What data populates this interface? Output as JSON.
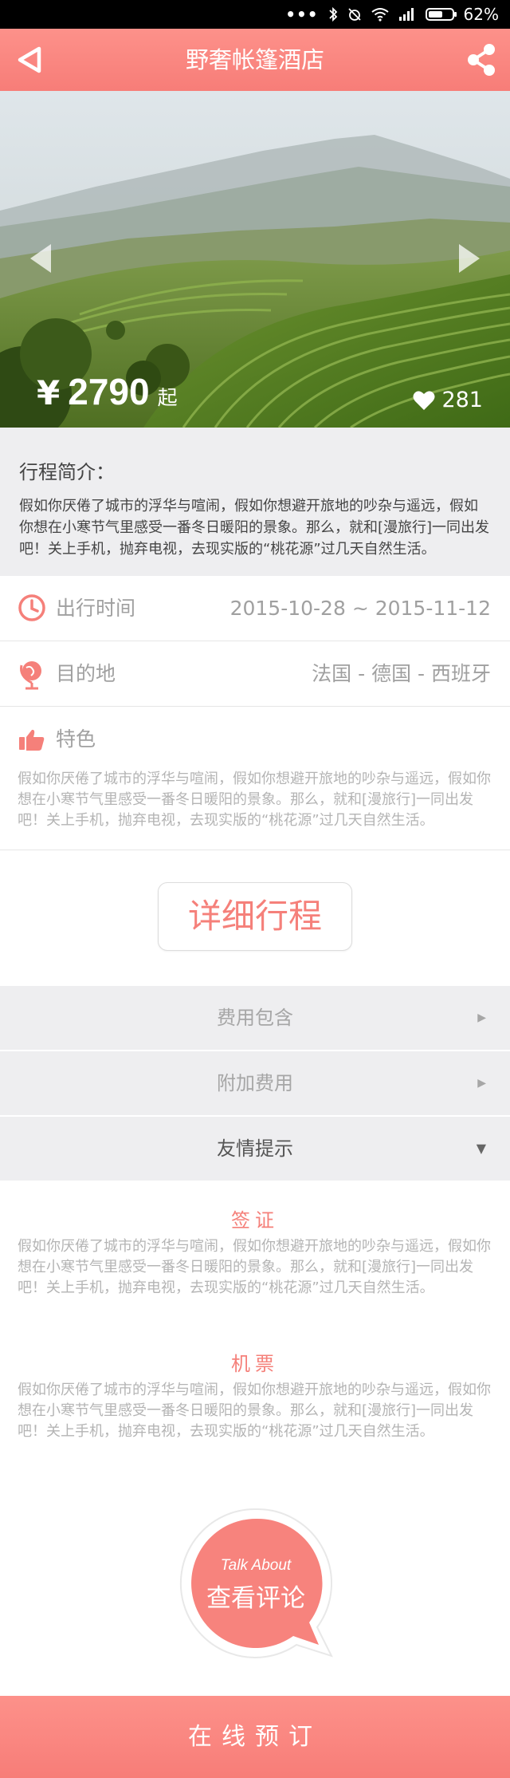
{
  "status_bar": {
    "dots": "•••",
    "battery": "62%",
    "battery_level": 0.62
  },
  "navbar": {
    "title": "野奢帐篷酒店",
    "back_icon": "back-triangle-icon",
    "share_icon": "share-icon"
  },
  "hero": {
    "currency": "¥",
    "price": "2790",
    "price_suffix": "起",
    "likes": "281",
    "like_icon": "heart-icon"
  },
  "intro": {
    "heading": "行程简介：",
    "text": "假如你厌倦了城市的浮华与喧闹，假如你想避开旅地的吵杂与遥远，假如你想在小寒节气里感受一番冬日暖阳的景象。那么，就和[漫旅行]一同出发吧！关上手机，抛弃电视，去现实版的“桃花源”过几天自然生活。"
  },
  "info": {
    "time_label": "出行时间",
    "time_value": "2015-10-28 ~ 2015-11-12",
    "dest_label": "目的地",
    "dest_value": "法国 - 德国 - 西班牙",
    "feature_label": "特色",
    "feature_text": "假如你厌倦了城市的浮华与喧闹，假如你想避开旅地的吵杂与遥远，假如你想在小寒节气里感受一番冬日暖阳的景象。那么，就和[漫旅行]一同出发吧！关上手机，抛弃电视，去现实版的“桃花源”过几天自然生活。"
  },
  "detail_button": "详细行程",
  "accordion": [
    {
      "label": "费用包含",
      "arrow": "▶"
    },
    {
      "label": "附加费用",
      "arrow": "▶"
    },
    {
      "label": "友情提示",
      "arrow": "▼"
    }
  ],
  "tips": [
    {
      "title": "签证",
      "text": "假如你厌倦了城市的浮华与喧闹，假如你想避开旅地的吵杂与遥远，假如你想在小寒节气里感受一番冬日暖阳的景象。那么，就和[漫旅行]一同出发吧！关上手机，抛弃电视，去现实版的“桃花源”过几天自然生活。"
    },
    {
      "title": "机票",
      "text": "假如你厌倦了城市的浮华与喧闹，假如你想避开旅地的吵杂与遥远，假如你想在小寒节气里感受一番冬日暖阳的景象。那么，就和[漫旅行]一同出发吧！关上手机，抛弃电视，去现实版的“桃花源”过几天自然生活。"
    }
  ],
  "talk": {
    "en": "Talk About",
    "cn": "查看评论"
  },
  "book_button": "在线预订",
  "colors": {
    "accent": "#f77d78",
    "panel": "#eeeef0",
    "muted_text": "#a0a0a0"
  }
}
